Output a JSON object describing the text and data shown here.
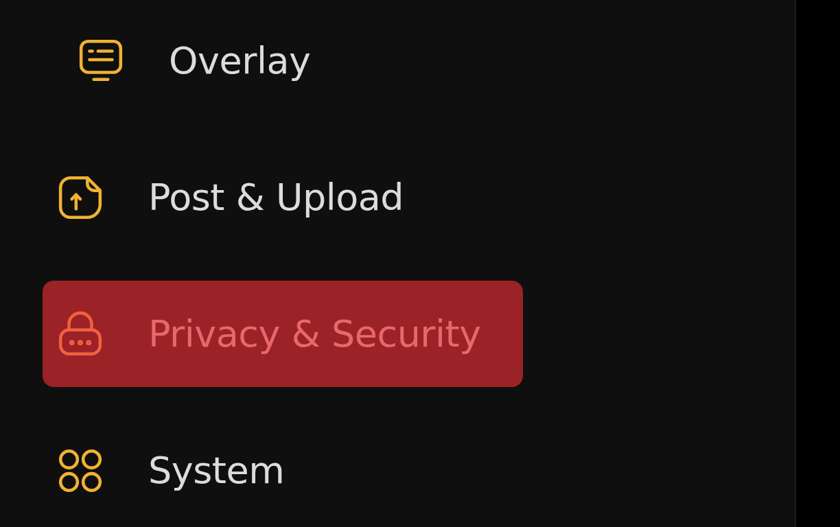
{
  "sidebar": {
    "items": [
      {
        "label": "Overlay",
        "selected": false,
        "indented": true
      },
      {
        "label": "Post & Upload",
        "selected": false,
        "indented": false
      },
      {
        "label": "Privacy & Security",
        "selected": true,
        "indented": false
      },
      {
        "label": "System",
        "selected": false,
        "indented": false
      }
    ]
  }
}
